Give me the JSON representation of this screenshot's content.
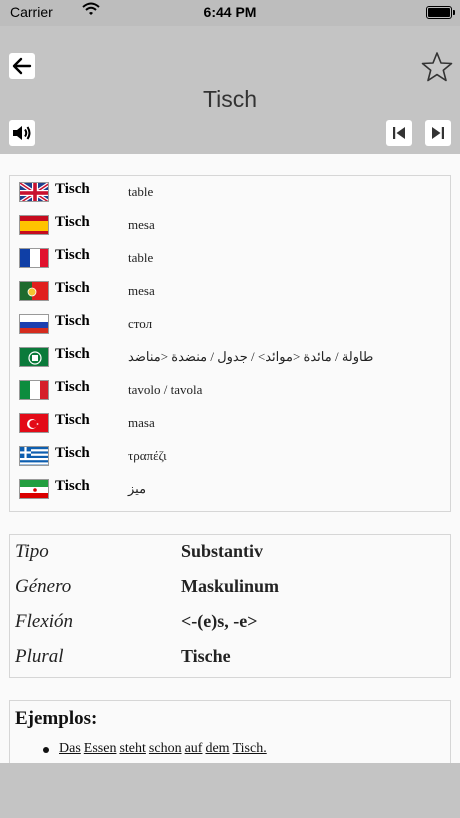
{
  "status": {
    "carrier": "Carrier",
    "time": "6:44 PM"
  },
  "header": {
    "title": "Tisch"
  },
  "translations": [
    {
      "lang": "en",
      "word": "Tisch",
      "translation": "table"
    },
    {
      "lang": "es",
      "word": "Tisch",
      "translation": "mesa"
    },
    {
      "lang": "fr",
      "word": "Tisch",
      "translation": "table"
    },
    {
      "lang": "pt",
      "word": "Tisch",
      "translation": "mesa"
    },
    {
      "lang": "ru",
      "word": "Tisch",
      "translation": "стол"
    },
    {
      "lang": "ar",
      "word": "Tisch",
      "translation": "طاولة / مائدة <موائد> / جدول / منضدة <مناضد"
    },
    {
      "lang": "it",
      "word": "Tisch",
      "translation": "tavolo / tavola"
    },
    {
      "lang": "tr",
      "word": "Tisch",
      "translation": "masa"
    },
    {
      "lang": "el",
      "word": "Tisch",
      "translation": "τραπέζι"
    },
    {
      "lang": "fa",
      "word": "Tisch",
      "translation": "میز"
    }
  ],
  "grammar": [
    {
      "label": "Tipo",
      "value": "Substantiv"
    },
    {
      "label": "Género",
      "value": "Maskulinum"
    },
    {
      "label": "Flexión",
      "value": "<-(e)s, -e>"
    },
    {
      "label": "Plural",
      "value": "Tische"
    }
  ],
  "examples": {
    "heading": "Ejemplos:",
    "items": [
      {
        "words": [
          "Das",
          "Essen",
          "steht",
          "schon",
          "auf",
          "dem",
          "Tisch."
        ]
      }
    ]
  },
  "icons": {
    "back": "arrow-left-icon",
    "favorite": "star-icon",
    "audio": "speaker-icon",
    "previous": "skip-previous-icon",
    "next": "skip-next-icon"
  }
}
